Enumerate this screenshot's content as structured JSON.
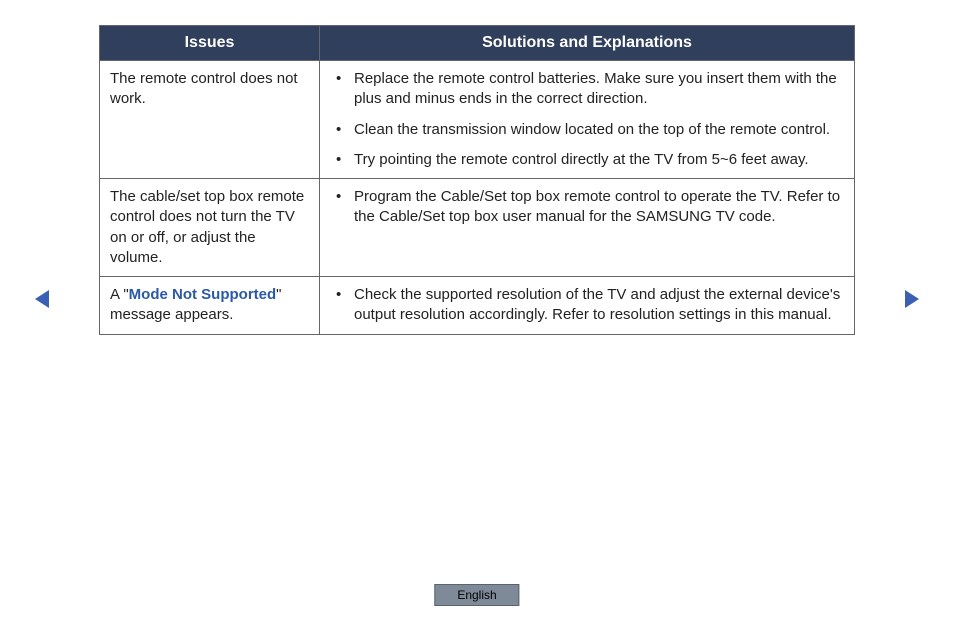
{
  "table": {
    "headers": {
      "issues": "Issues",
      "solutions": "Solutions and Explanations"
    },
    "rows": [
      {
        "issue": "The remote control does not work.",
        "solutions": [
          "Replace the remote control batteries. Make sure you insert them with the plus and minus ends in the correct direction.",
          "Clean the transmission window located on the top of the remote control.",
          "Try pointing the remote control directly at the TV from 5~6 feet away."
        ]
      },
      {
        "issue": "The cable/set top box remote control does not turn the TV on or off, or adjust the volume.",
        "solutions": [
          "Program the Cable/Set top box remote control to operate the TV. Refer to the Cable/Set top box user manual for the SAMSUNG TV code."
        ]
      },
      {
        "issue_prefix": "A \"",
        "issue_highlight": "Mode Not Supported",
        "issue_suffix": "\" message appears.",
        "solutions": [
          "Check the supported resolution of the TV and adjust the external device's output resolution accordingly. Refer to resolution settings in this manual."
        ]
      }
    ]
  },
  "language": "English"
}
